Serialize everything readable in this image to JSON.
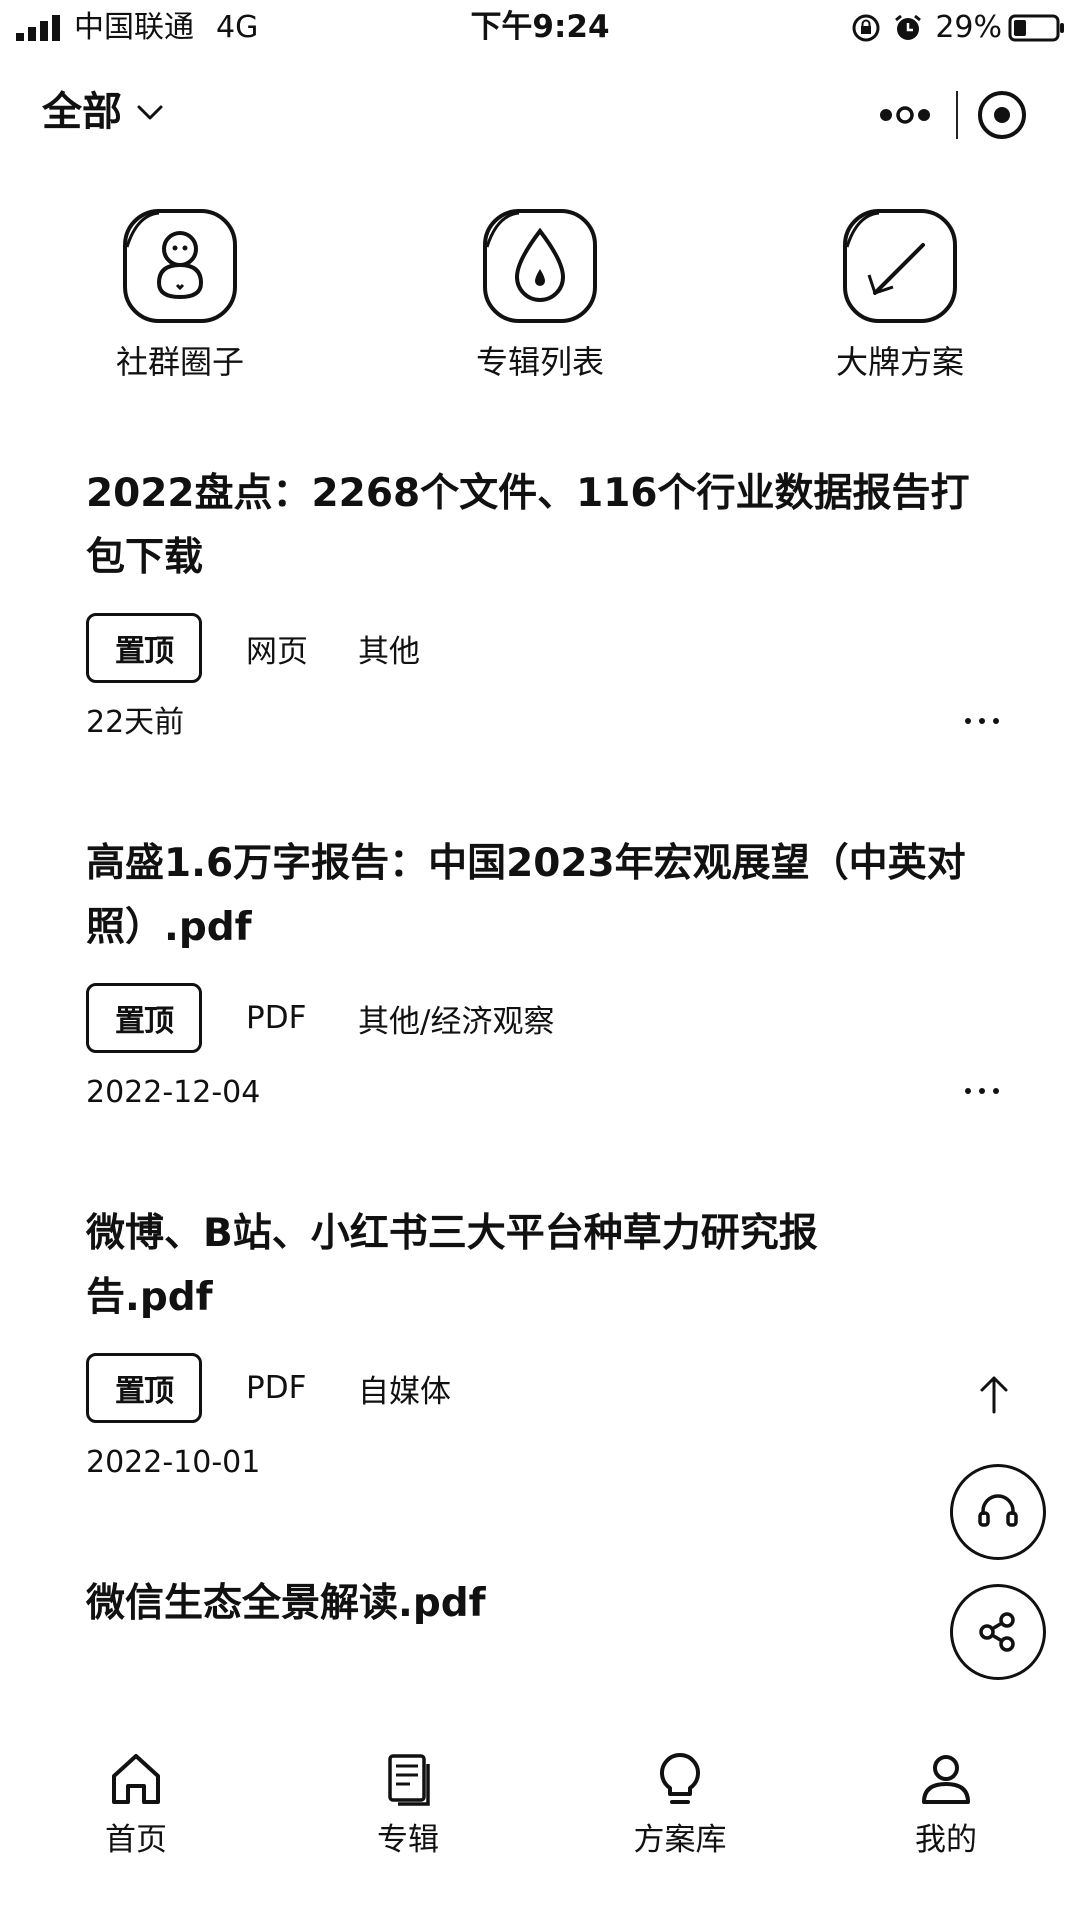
{
  "status_bar": {
    "carrier": "中国联通",
    "network": "4G",
    "time": "下午9:24",
    "battery": "29%"
  },
  "header": {
    "filter_label": "全部",
    "icons": [
      "chevron-down-icon",
      "more-dots-icon",
      "close-target-icon"
    ]
  },
  "quick_entries": [
    {
      "label": "社群圈子",
      "icon": "community-icon"
    },
    {
      "label": "专辑列表",
      "icon": "album-drop-icon"
    },
    {
      "label": "大牌方案",
      "icon": "pen-icon"
    }
  ],
  "feed": [
    {
      "title": "2022盘点：2268个文件、116个行业数据报告打包下载",
      "pin_label": "置顶",
      "type": "网页",
      "category": "其他",
      "date": "22天前",
      "has_more": true
    },
    {
      "title": "高盛1.6万字报告：中国2023年宏观展望（中英对照）.pdf",
      "pin_label": "置顶",
      "type": "PDF",
      "category": "其他/经济观察",
      "date": "2022-12-04",
      "has_more": true
    },
    {
      "title": "微博、B站、小红书三大平台种草力研究报告.pdf",
      "pin_label": "置顶",
      "type": "PDF",
      "category": "自媒体",
      "date": "2022-10-01",
      "has_more": false
    },
    {
      "title": "微信生态全景解读.pdf"
    }
  ],
  "tabbar": [
    {
      "label": "首页",
      "icon": "home-icon"
    },
    {
      "label": "专辑",
      "icon": "album-icon"
    },
    {
      "label": "方案库",
      "icon": "bulb-icon"
    },
    {
      "label": "我的",
      "icon": "user-icon"
    }
  ]
}
